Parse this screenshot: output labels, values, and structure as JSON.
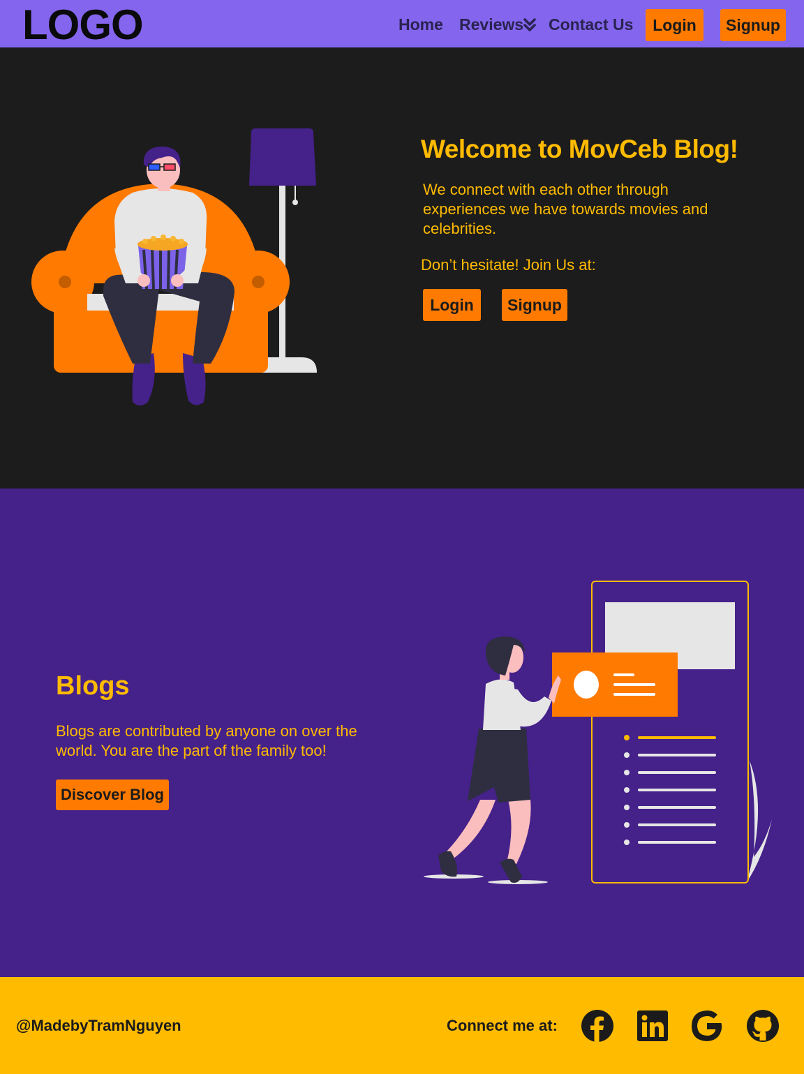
{
  "header": {
    "logo": "LOGO",
    "nav": {
      "home": "Home",
      "reviews": "Reviews",
      "contact": "Contact Us"
    },
    "login": "Login",
    "signup": "Signup"
  },
  "hero": {
    "title": "Welcome to MovCeb Blog!",
    "description": "We connect with each other through experiences we have towards movies and celebrities.",
    "join_text": "Don’t hesitate! Join Us at:",
    "login": "Login",
    "signup": "Signup"
  },
  "blogs": {
    "title": "Blogs",
    "description": "Blogs are contributed by anyone on over the world. You are the part of the family too!",
    "button": "Discover Blog"
  },
  "footer": {
    "credit": "@MadebyTramNguyen",
    "connect": "Connect me at:",
    "icons": [
      "facebook-icon",
      "linkedin-icon",
      "google-icon",
      "github-icon"
    ]
  },
  "colors": {
    "header_bg": "#8365ee",
    "hero_bg": "#1c1c1c",
    "blogs_bg": "#45218a",
    "footer_bg": "#ffbb00",
    "accent_button": "#ff7a00",
    "accent_text": "#ffbb00"
  }
}
